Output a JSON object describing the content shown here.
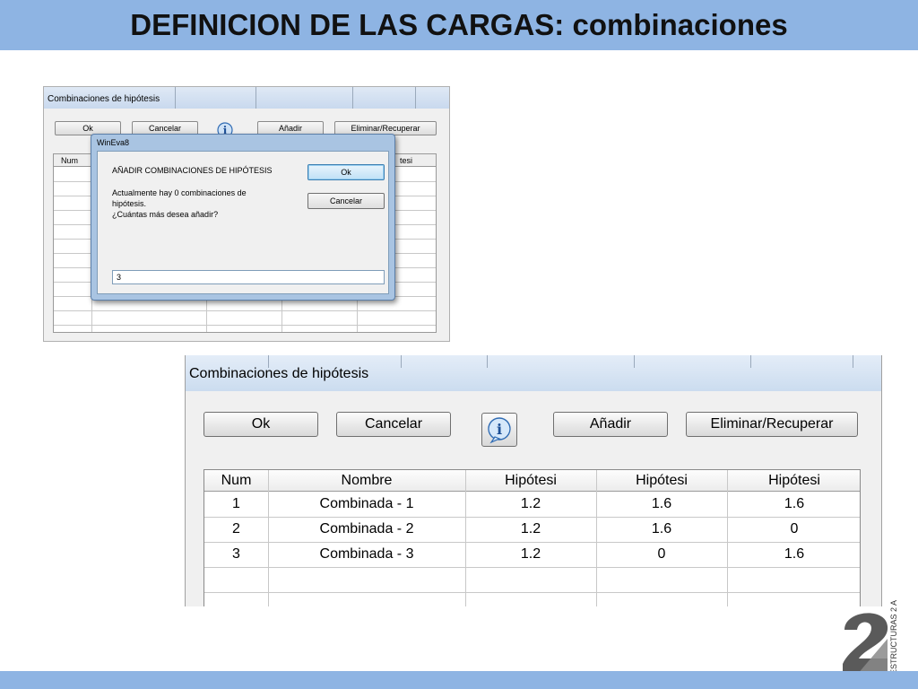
{
  "slide": {
    "title": "DEFINICION DE LAS CARGAS: combinaciones",
    "logo_text": "ESTRUCTURAS 2 A"
  },
  "small_window": {
    "title": "Combinaciones de hipótesis",
    "buttons": {
      "ok": "Ok",
      "cancel": "Cancelar",
      "add": "Añadir",
      "delete": "Eliminar/Recuperar"
    },
    "table_headers": {
      "num": "Num",
      "last": "tesi"
    }
  },
  "dialog": {
    "title": "WinEva8",
    "heading": "AÑADIR COMBINACIONES DE HIPÓTESIS",
    "message_lines": [
      "Actualmente hay 0 combinaciones de",
      "hipótesis.",
      "¿Cuántas más desea añadir?"
    ],
    "ok_label": "Ok",
    "cancel_label": "Cancelar",
    "input_value": "3"
  },
  "big_window": {
    "title": "Combinaciones de hipótesis",
    "buttons": {
      "ok": "Ok",
      "cancel": "Cancelar",
      "add": "Añadir",
      "delete": "Eliminar/Recuperar"
    },
    "info_icon": "info-icon",
    "table": {
      "headers": [
        "Num",
        "Nombre",
        "Hipótesi",
        "Hipótesi",
        "Hipótesi"
      ],
      "rows": [
        [
          "1",
          "Combinada - 1",
          "1.2",
          "1.6",
          "1.6"
        ],
        [
          "2",
          "Combinada - 2",
          "1.2",
          "1.6",
          "0"
        ],
        [
          "3",
          "Combinada - 3",
          "1.2",
          "0",
          "1.6"
        ]
      ]
    }
  }
}
